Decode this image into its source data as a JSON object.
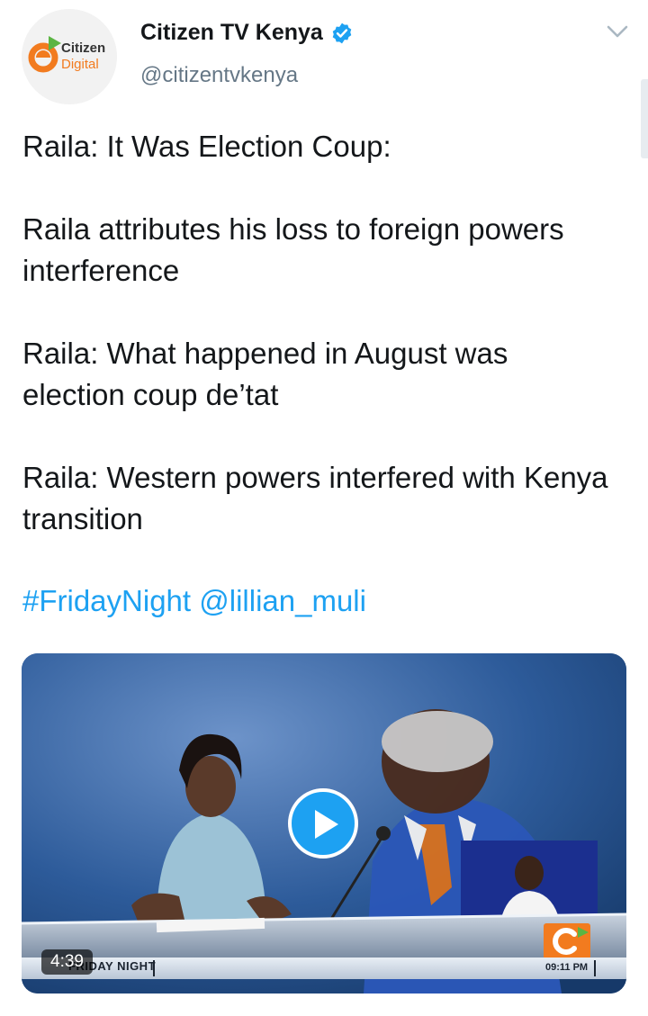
{
  "account": {
    "display_name": "Citizen TV Kenya",
    "handle": "@citizentvkenya",
    "avatar_text_line1": "Citizen",
    "avatar_text_line2": "Digital",
    "verified_icon": "verified-badge-icon"
  },
  "tweet": {
    "lines": [
      "Raila: It Was Election Coup:",
      "Raila attributes his loss to foreign powers interference",
      "Raila: What happened in August was election coup de’tat",
      "Raila: Western powers interfered with Kenya transition"
    ],
    "hashtag": "#FridayNight",
    "mention": "@lillian_muli"
  },
  "media": {
    "duration": "4:39",
    "show_name": "FRIDAY NIGHT",
    "clock": "09:11 PM"
  },
  "colors": {
    "link": "#1da1f2",
    "text": "#14171a",
    "secondary": "#657786",
    "verified": "#1da1f2",
    "brand_orange": "#f27b1f",
    "brand_green": "#5bb543"
  },
  "icons": {
    "menu": "chevron-down-icon",
    "play": "play-icon"
  }
}
